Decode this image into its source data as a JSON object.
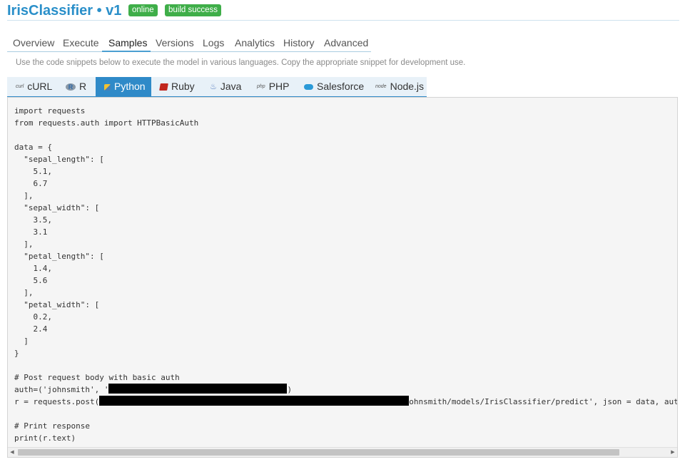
{
  "header": {
    "title": "IrisClassifier • v1",
    "badges": [
      "online",
      "build success"
    ],
    "badge_color": "#3fae49",
    "title_color": "#2a8fc9"
  },
  "nav": {
    "items": [
      "Overview",
      "Execute",
      "Samples",
      "Versions",
      "Logs",
      "Analytics",
      "History",
      "Advanced"
    ],
    "active": "Samples"
  },
  "description": "Use the code snippets below to execute the model in various languages. Copy the appropriate snippet for development use.",
  "languages": {
    "tabs": [
      {
        "label": "cURL",
        "icon": "curl-icon",
        "icon_text": "curl"
      },
      {
        "label": "R",
        "icon": "r-logo-icon",
        "icon_text": "R"
      },
      {
        "label": "Python",
        "icon": "python-logo-icon",
        "icon_text": ""
      },
      {
        "label": "Ruby",
        "icon": "ruby-logo-icon",
        "icon_text": ""
      },
      {
        "label": "Java",
        "icon": "java-logo-icon",
        "icon_text": "♨"
      },
      {
        "label": "PHP",
        "icon": "php-logo-icon",
        "icon_text": "php"
      },
      {
        "label": "Salesforce",
        "icon": "salesforce-logo-icon",
        "icon_text": ""
      },
      {
        "label": "Node.js",
        "icon": "nodejs-logo-icon",
        "icon_text": "node"
      }
    ],
    "active": "Python",
    "accent": "#2f8ac8"
  },
  "code": {
    "before_auth": "import requests\nfrom requests.auth import HTTPBasicAuth\n\ndata = {\n  \"sepal_length\": [\n    5.1,\n    6.7\n  ],\n  \"sepal_width\": [\n    3.5,\n    3.1\n  ],\n  \"petal_length\": [\n    1.4,\n    5.6\n  ],\n  \"petal_width\": [\n    0.2,\n    2.4\n  ]\n}\n\n# Post request body with basic auth\n",
    "auth_prefix": "auth=('johnsmith', '",
    "auth_suffix": ")",
    "post_prefix": "r = requests.post(",
    "post_suffix": "ohnsmith/models/IrisClassifier/predict', json = data, auth=auth)",
    "after": "\n\n# Print response\nprint(r.text)"
  }
}
